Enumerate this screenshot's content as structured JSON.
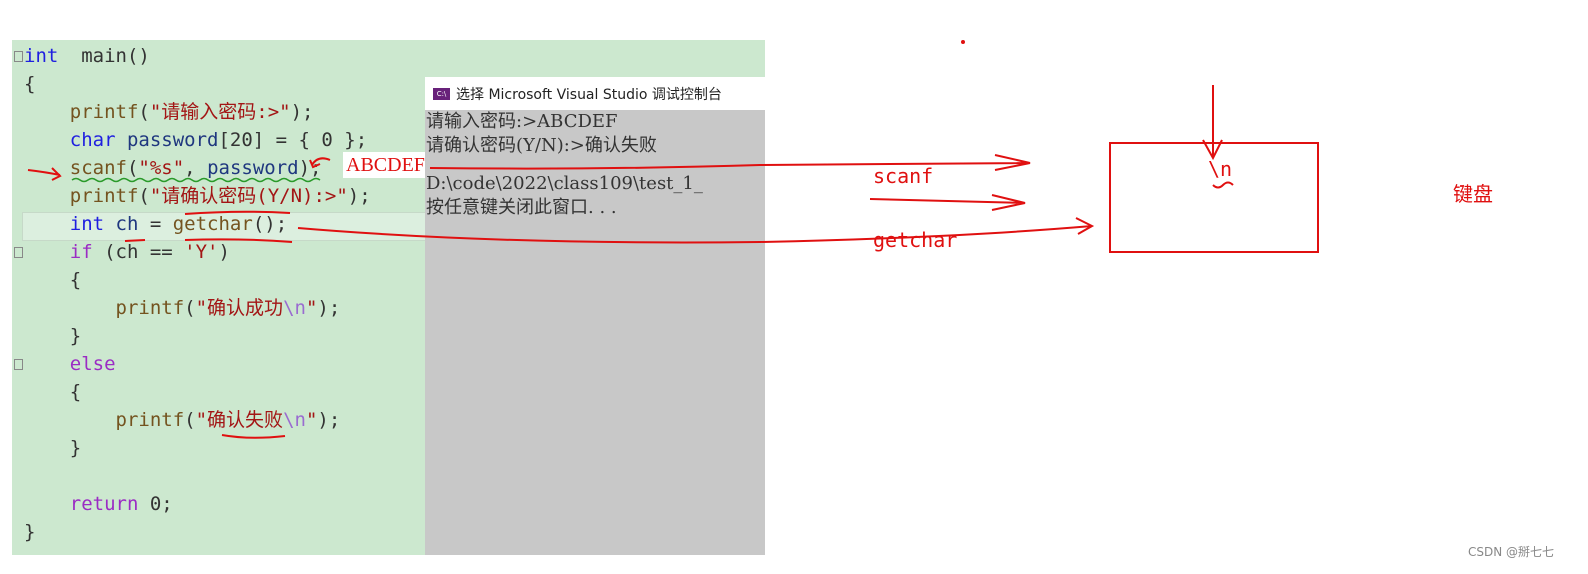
{
  "editor": {
    "lines": [
      [
        [
          "kw",
          "int"
        ],
        [
          "",
          "  main()"
        ]
      ],
      [
        [
          "",
          "{"
        ]
      ],
      [
        [
          "fn",
          "    printf"
        ],
        [
          "",
          "("
        ],
        [
          "st",
          "\"请输入密码:>\""
        ],
        [
          "",
          ");"
        ]
      ],
      [
        [
          "kw",
          "    char"
        ],
        [
          "var",
          " password"
        ],
        [
          "",
          "[20] = { 0 };"
        ]
      ],
      [
        [
          "fn",
          "    scanf"
        ],
        [
          "",
          "("
        ],
        [
          "st",
          "\"%s\""
        ],
        [
          "",
          ", "
        ],
        [
          "var",
          "password"
        ],
        [
          "",
          ");"
        ]
      ],
      [
        [
          "fn",
          "    printf"
        ],
        [
          "",
          "("
        ],
        [
          "st",
          "\"请确认密码(Y/N):>\""
        ],
        [
          "",
          ");"
        ]
      ],
      [
        [
          "kw",
          "    int"
        ],
        [
          "var",
          " ch"
        ],
        [
          "",
          " = "
        ],
        [
          "fn",
          "getchar"
        ],
        [
          "",
          "();"
        ]
      ],
      [
        [
          "kp",
          "    if"
        ],
        [
          "",
          " (ch == "
        ],
        [
          "st",
          "'Y'"
        ],
        [
          "",
          ")"
        ]
      ],
      [
        [
          "",
          "    {"
        ]
      ],
      [
        [
          "fn",
          "        printf"
        ],
        [
          "",
          "("
        ],
        [
          "st",
          "\"确认成功"
        ],
        [
          "esc",
          "\\n"
        ],
        [
          "st",
          "\""
        ],
        [
          "",
          ");"
        ]
      ],
      [
        [
          "",
          "    }"
        ]
      ],
      [
        [
          "kp",
          "    else"
        ]
      ],
      [
        [
          "",
          "    {"
        ]
      ],
      [
        [
          "fn",
          "        printf"
        ],
        [
          "",
          "("
        ],
        [
          "st",
          "\"确认失败"
        ],
        [
          "esc",
          "\\n"
        ],
        [
          "st",
          "\""
        ],
        [
          "",
          ");"
        ]
      ],
      [
        [
          "",
          "    }"
        ]
      ],
      [
        [
          "",
          ""
        ]
      ],
      [
        [
          "kp",
          "    return"
        ],
        [
          "",
          " 0;"
        ]
      ],
      [
        [
          "",
          "}"
        ]
      ]
    ]
  },
  "console": {
    "title": "选择 Microsoft Visual Studio 调试控制台",
    "icon": "console-app-icon",
    "lines": [
      "请输入密码:>ABCDEF",
      "请确认密码(Y/N):>确认失败",
      "",
      "D:\\code\\2022\\class109\\test_1_",
      "按任意键关闭此窗口. . ."
    ]
  },
  "annotations": {
    "input": "ABCDEF",
    "scanf": "scanf",
    "getchar": "getchar",
    "buffer_newline": "\\n",
    "keyboard": "键盘",
    "color": "#e01010"
  },
  "watermark": "CSDN @掰七七"
}
